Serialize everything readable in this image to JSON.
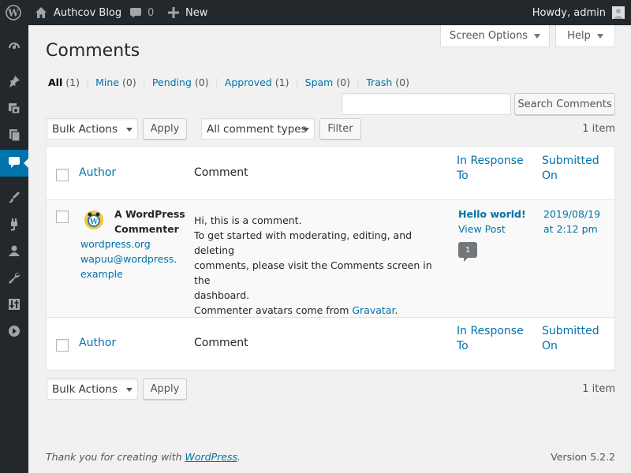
{
  "adminbar": {
    "site_name": "Authcov Blog",
    "comments_count": "0",
    "new_label": "New",
    "howdy": "Howdy, admin"
  },
  "screen_meta": {
    "options_label": "Screen Options",
    "help_label": "Help"
  },
  "page": {
    "title": "Comments"
  },
  "filters": [
    {
      "label": "All",
      "count": "(1)",
      "current": true
    },
    {
      "label": "Mine",
      "count": "(0)"
    },
    {
      "label": "Pending",
      "count": "(0)"
    },
    {
      "label": "Approved",
      "count": "(1)"
    },
    {
      "label": "Spam",
      "count": "(0)"
    },
    {
      "label": "Trash",
      "count": "(0)"
    }
  ],
  "search": {
    "value": "",
    "button_label": "Search Comments"
  },
  "toolbar_top": {
    "bulk_actions": "Bulk Actions",
    "apply_label": "Apply",
    "comment_types": "All comment types",
    "filter_label": "Filter",
    "items_count": "1 item"
  },
  "table": {
    "columns": {
      "author": "Author",
      "comment": "Comment",
      "in_response_to_1": "In Response",
      "in_response_to_2": "To",
      "submitted_on_1": "Submitted",
      "submitted_on_2": "On"
    },
    "rows": [
      {
        "author_name_1": "A WordPress",
        "author_name_2": "Commenter",
        "author_url": "wordpress.org",
        "author_email_1": "wapuu@wordpress.",
        "author_email_2": "example",
        "comment_line_1": "Hi, this is a comment.",
        "comment_line_2": "To get started with moderating, editing, and deleting",
        "comment_line_3": "comments, please visit the Comments screen in the",
        "comment_line_4": "dashboard.",
        "comment_line_5_prefix": "Commenter avatars come from ",
        "comment_link": "Gravatar",
        "comment_line_5_suffix": ".",
        "post_title": "Hello world!",
        "view_post": "View Post",
        "comment_bubble_count": "1",
        "date_line_1": "2019/08/19",
        "date_line_2": "at 2:12 pm"
      }
    ]
  },
  "toolbar_bottom": {
    "bulk_actions": "Bulk Actions",
    "apply_label": "Apply",
    "items_count": "1 item"
  },
  "footer": {
    "thanks_prefix": "Thank you for creating with ",
    "thanks_link": "WordPress",
    "thanks_suffix": ".",
    "version": "Version 5.2.2"
  },
  "colors": {
    "adminbar": "#23282d",
    "accent": "#0073aa",
    "background": "#f1f1f1"
  },
  "icons": [
    "wordpress-logo-icon",
    "home-icon",
    "comment-bubble-icon",
    "plus-icon",
    "dashboard-icon",
    "pin-icon",
    "media-icon",
    "pages-icon",
    "comments-icon",
    "appearance-icon",
    "plugins-icon",
    "users-icon",
    "tools-icon",
    "settings-icon",
    "collapse-icon"
  ]
}
